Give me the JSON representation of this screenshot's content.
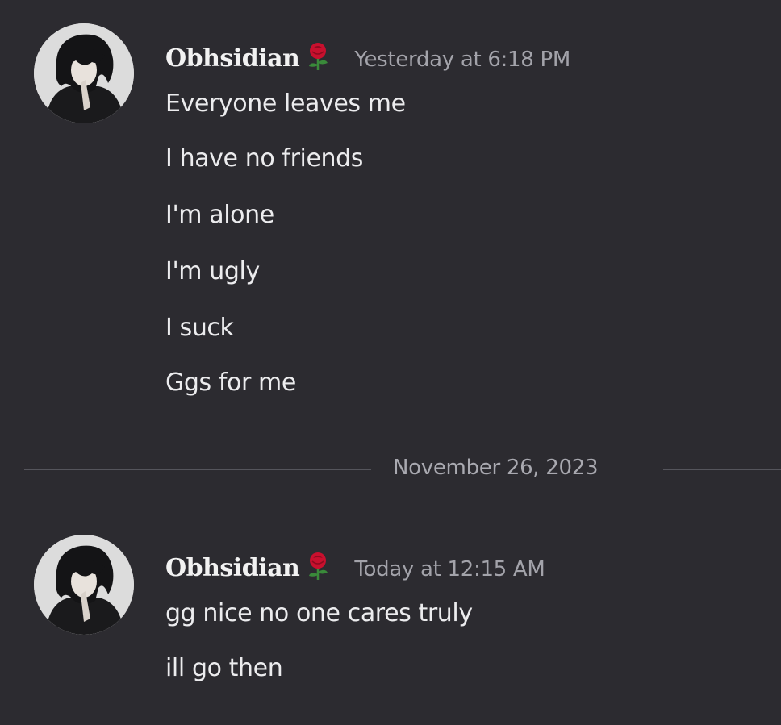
{
  "messages": [
    {
      "author": "Obhsidian",
      "timestamp": "Yesterday at 6:18 PM",
      "lines": [
        "Everyone leaves me",
        "I have no friends",
        "I'm alone",
        "I'm ugly",
        "I suck",
        "Ggs for me"
      ]
    },
    {
      "author": "Obhsidian",
      "timestamp": "Today at 12:15 AM",
      "lines": [
        "gg nice no one cares truly",
        "ill go then"
      ]
    }
  ],
  "date_divider": "November 26, 2023",
  "icons": {
    "author_badge": "rose-icon",
    "avatar": "avatar-image"
  },
  "colors": {
    "background": "#2c2b30",
    "text": "#ececee",
    "timestamp": "#a3a3aa",
    "rose": "#c8102e"
  }
}
